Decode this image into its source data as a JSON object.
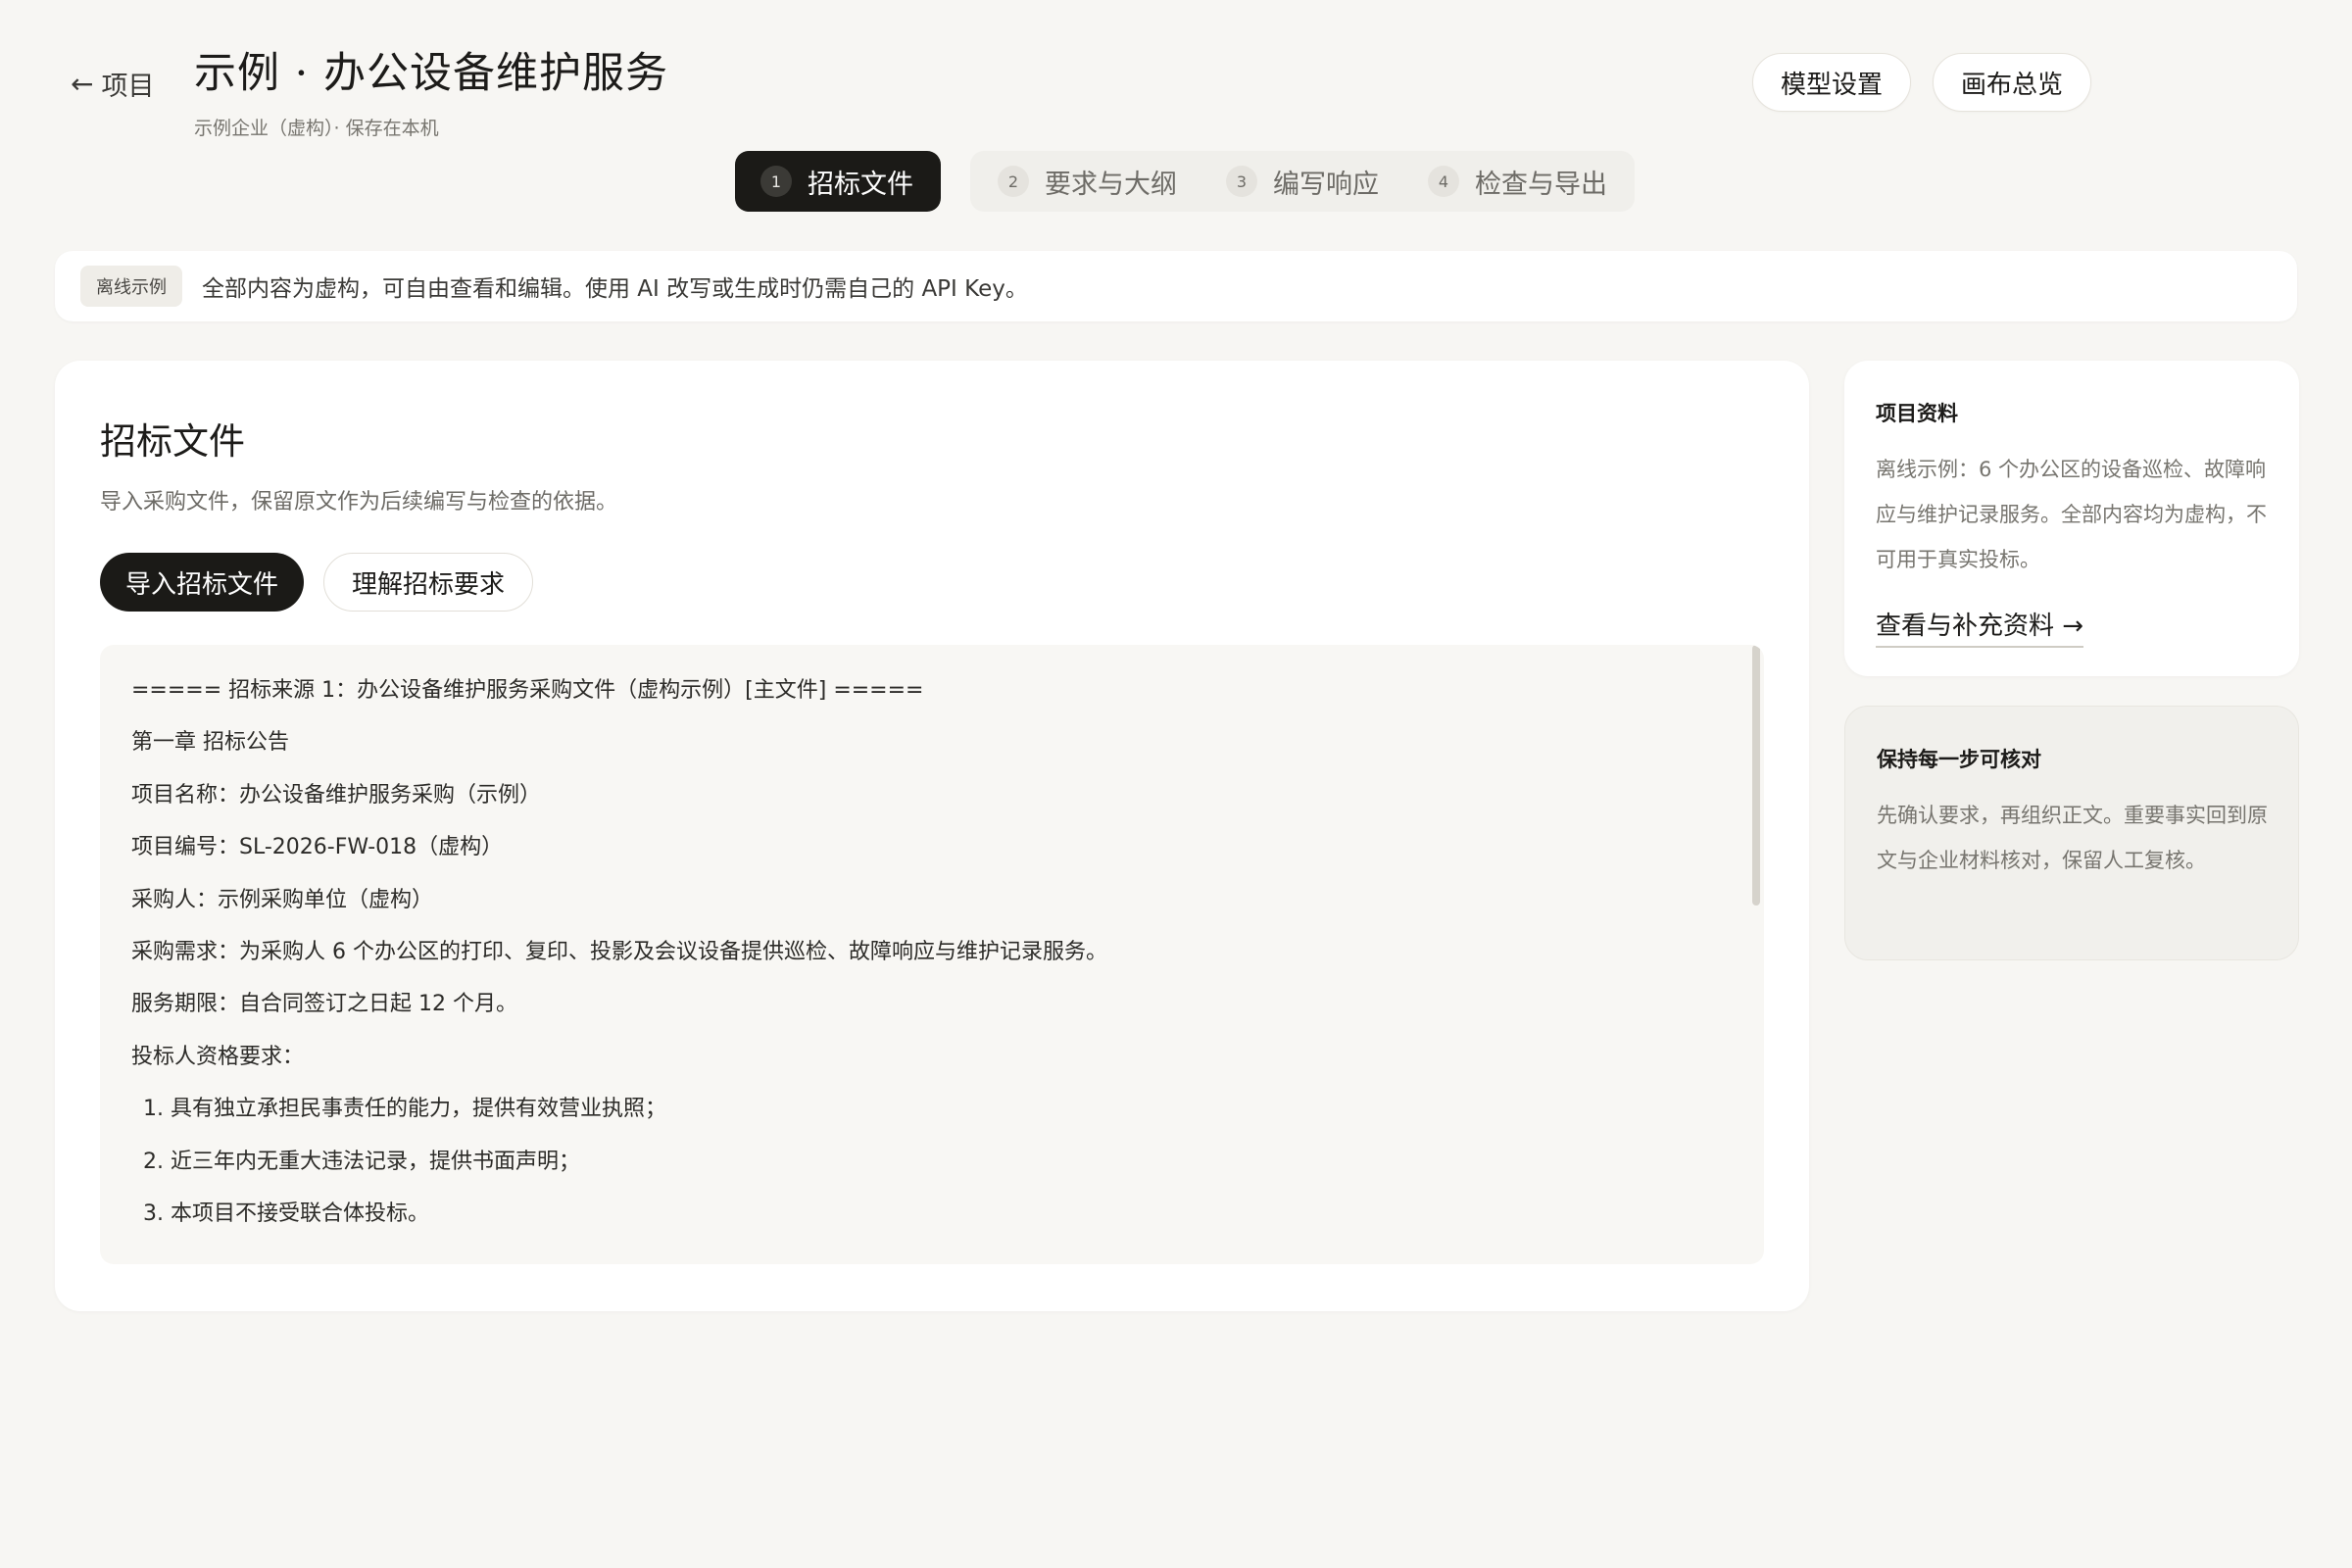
{
  "header": {
    "back_label": "项目",
    "title": "示例 · 办公设备维护服务",
    "subtitle": "示例企业（虚构）· 保存在本机",
    "model_settings": "模型设置",
    "canvas_overview": "画布总览"
  },
  "steps": [
    {
      "num": "1",
      "label": "招标文件"
    },
    {
      "num": "2",
      "label": "要求与大纲"
    },
    {
      "num": "3",
      "label": "编写响应"
    },
    {
      "num": "4",
      "label": "检查与导出"
    }
  ],
  "notice": {
    "badge": "离线示例",
    "text": "全部内容为虚构，可自由查看和编辑。使用 AI 改写或生成时仍需自己的 API Key。"
  },
  "main": {
    "title": "招标文件",
    "description": "导入采购文件，保留原文作为后续编写与检查的依据。",
    "import_button": "导入招标文件",
    "understand_button": "理解招标要求",
    "document_lines": [
      "===== 招标来源 1：办公设备维护服务采购文件（虚构示例）[主文件] =====",
      "第一章 招标公告",
      "项目名称：办公设备维护服务采购（示例）",
      "项目编号：SL-2026-FW-018（虚构）",
      "采购人：示例采购单位（虚构）",
      "采购需求：为采购人 6 个办公区的打印、复印、投影及会议设备提供巡检、故障响应与维护记录服务。",
      "服务期限：自合同签订之日起 12 个月。",
      "投标人资格要求：",
      "1. 具有独立承担民事责任的能力，提供有效营业执照；",
      "2. 近三年内无重大违法记录，提供书面声明；",
      "3. 本项目不接受联合体投标。"
    ]
  },
  "sidebar": {
    "info_title": "项目资料",
    "info_text": "离线示例：6 个办公区的设备巡检、故障响应与维护记录服务。全部内容均为虚构，不可用于真实投标。",
    "info_link": "查看与补充资料 →",
    "tip_title": "保持每一步可核对",
    "tip_text": "先确认要求，再组织正文。重要事实回到原文与企业材料核对，保留人工复核。"
  }
}
